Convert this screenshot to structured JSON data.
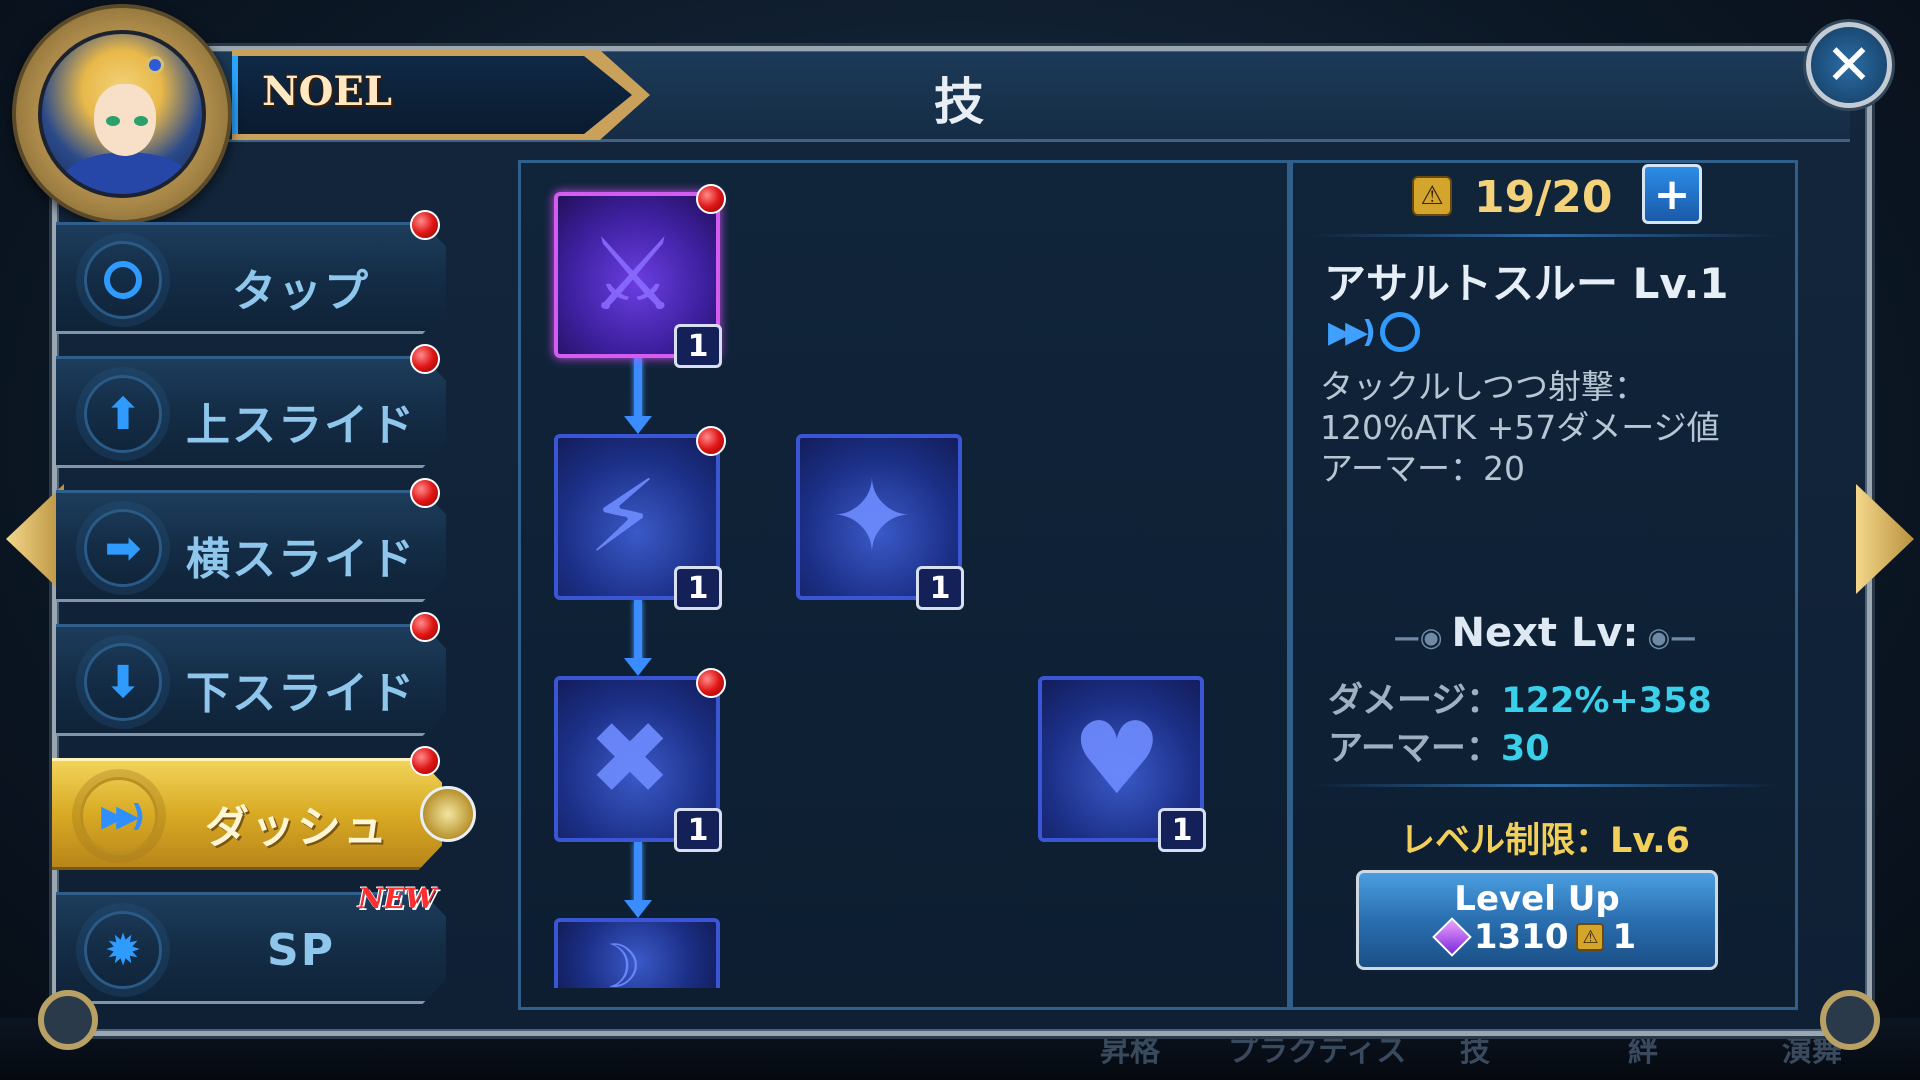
{
  "character": {
    "name": "NOEL"
  },
  "header": {
    "title": "技"
  },
  "close": {
    "symbol": "✕"
  },
  "sidebar": {
    "items": [
      {
        "label": "タップ",
        "icon": "circle-icon",
        "active": false,
        "notification": true
      },
      {
        "label": "上スライド",
        "icon": "up-arrow-icon",
        "active": false,
        "notification": true
      },
      {
        "label": "横スライド",
        "icon": "right-arrow-icon",
        "active": false,
        "notification": true
      },
      {
        "label": "下スライド",
        "icon": "down-arrow-icon",
        "active": false,
        "notification": true
      },
      {
        "label": "ダッシュ",
        "icon": "dash-icon",
        "active": true,
        "notification": true
      },
      {
        "label": "SP",
        "icon": "burst-icon",
        "active": false,
        "notification": false,
        "badge": "NEW"
      }
    ]
  },
  "skill_tree": {
    "nodes": [
      {
        "name": "assault-through",
        "level": "1",
        "selected": true,
        "notification": true
      },
      {
        "name": "shotgun-slash",
        "level": "1",
        "selected": false,
        "notification": true
      },
      {
        "name": "gun-burst",
        "level": "1",
        "selected": false,
        "notification": false
      },
      {
        "name": "cross-guns",
        "level": "1",
        "selected": false,
        "notification": true
      },
      {
        "name": "heart-guard",
        "level": "1",
        "selected": false,
        "notification": false
      },
      {
        "name": "next-skill",
        "level": "",
        "selected": false,
        "notification": false
      }
    ]
  },
  "detail": {
    "points": "19/20",
    "plus_label": "+",
    "skill_name": "アサルトスルー Lv.1",
    "description": "タックルしつつ射撃：\n120%ATK +57ダメージ値\nアーマー：20",
    "next_label": "Next Lv:",
    "damage_label": "ダメージ：",
    "damage_value": "122%+358",
    "armor_label": "アーマー：",
    "armor_value": "30",
    "level_limit": "レベル制限：Lv.6",
    "levelup_label": "Level Up",
    "levelup_gem_cost": "1310",
    "levelup_point_cost": "1"
  },
  "bottom_tabs": [
    "昇格",
    "プラクティス",
    "技",
    "絆",
    "演舞"
  ],
  "colors": {
    "accent_blue": "#3a8cff",
    "gold": "#f1cf58",
    "cyan_value": "#3ad0ea",
    "selected_purple": "#d45cf0"
  }
}
